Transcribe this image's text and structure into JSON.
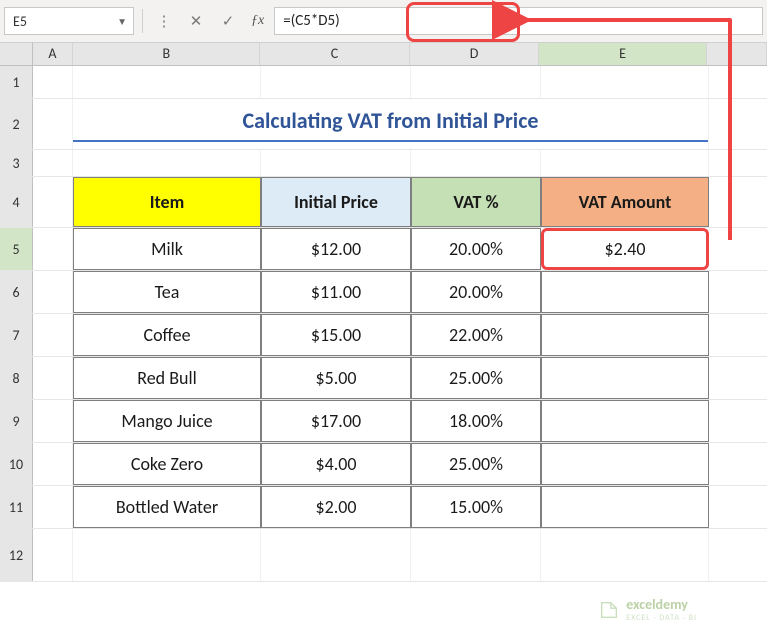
{
  "formula_bar": {
    "cell_ref": "E5",
    "formula": "=(C5*D5)"
  },
  "columns": {
    "A": "A",
    "B": "B",
    "C": "C",
    "D": "D",
    "E": "E",
    "F": ""
  },
  "row_nums": [
    "1",
    "2",
    "3",
    "4",
    "5",
    "6",
    "7",
    "8",
    "9",
    "10",
    "11",
    "12"
  ],
  "title": "Calculating VAT from Initial Price",
  "headers": {
    "item": "Item",
    "initial_price": "Initial Price",
    "vat_pct": "VAT %",
    "vat_amount": "VAT Amount"
  },
  "rows": [
    {
      "item": "Milk",
      "price": "$12.00",
      "vat": "20.00%",
      "amount": "$2.40"
    },
    {
      "item": "Tea",
      "price": "$11.00",
      "vat": "20.00%",
      "amount": ""
    },
    {
      "item": "Coffee",
      "price": "$15.00",
      "vat": "22.00%",
      "amount": ""
    },
    {
      "item": "Red Bull",
      "price": "$5.00",
      "vat": "25.00%",
      "amount": ""
    },
    {
      "item": "Mango Juice",
      "price": "$17.00",
      "vat": "18.00%",
      "amount": ""
    },
    {
      "item": "Coke Zero",
      "price": "$4.00",
      "vat": "25.00%",
      "amount": ""
    },
    {
      "item": "Bottled Water",
      "price": "$2.00",
      "vat": "15.00%",
      "amount": ""
    }
  ],
  "watermark": {
    "brand": "exceldemy",
    "tag": "EXCEL · DATA · BI"
  },
  "chart_data": {
    "type": "table",
    "title": "Calculating VAT from Initial Price",
    "columns": [
      "Item",
      "Initial Price",
      "VAT %",
      "VAT Amount"
    ],
    "data": [
      [
        "Milk",
        12.0,
        0.2,
        2.4
      ],
      [
        "Tea",
        11.0,
        0.2,
        null
      ],
      [
        "Coffee",
        15.0,
        0.22,
        null
      ],
      [
        "Red Bull",
        5.0,
        0.25,
        null
      ],
      [
        "Mango Juice",
        17.0,
        0.18,
        null
      ],
      [
        "Coke Zero",
        4.0,
        0.25,
        null
      ],
      [
        "Bottled Water",
        2.0,
        0.15,
        null
      ]
    ],
    "formula": "VAT Amount = Initial Price * VAT %"
  }
}
